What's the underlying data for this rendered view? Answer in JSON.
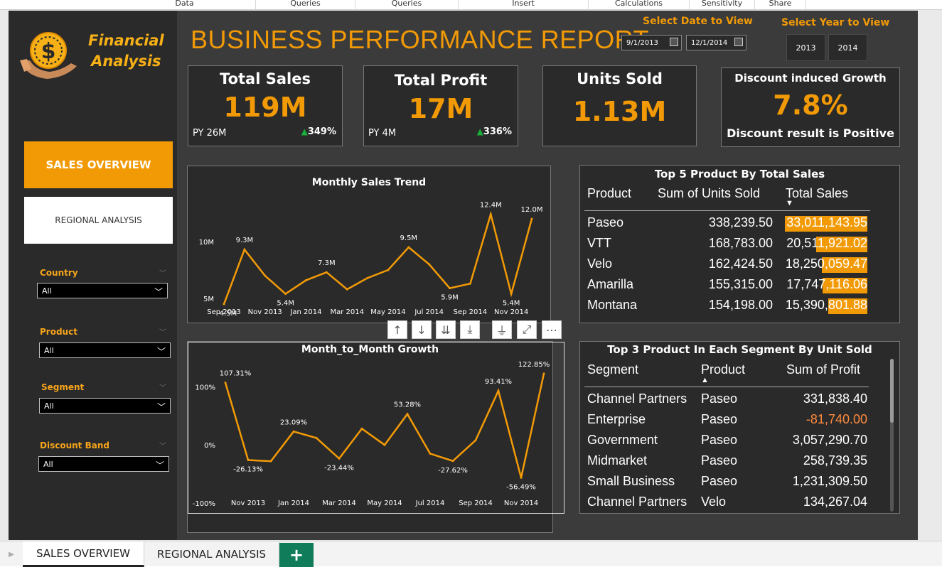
{
  "ribbon": {
    "items": [
      "Data",
      "Queries",
      "Insert",
      "Calculations",
      "Sensitivity",
      "Share"
    ]
  },
  "brand": {
    "line1": "Financial",
    "line2": "Analysis",
    "icon": "dollar-hand-icon"
  },
  "nav": {
    "active": "SALES OVERVIEW",
    "inactive": "REGIONAL ANALYSIS"
  },
  "slicers": [
    {
      "label": "Country",
      "value": "All"
    },
    {
      "label": "Product",
      "value": "All"
    },
    {
      "label": "Segment",
      "value": "All"
    },
    {
      "label": "Discount Band",
      "value": "All"
    }
  ],
  "header": {
    "title": "BUSINESS PERFORMANCE REPORT",
    "date_label": "Select Date to View",
    "date_start": "9/1/2013",
    "date_end": "12/1/2014",
    "year_label": "Select Year to View",
    "years": [
      "2013",
      "2014"
    ]
  },
  "kpis": {
    "sales": {
      "title": "Total Sales",
      "value": "119M",
      "py": "PY 26M",
      "growth": "349%"
    },
    "profit": {
      "title": "Total Profit",
      "value": "17M",
      "py": "PY  4M",
      "growth": "336%"
    },
    "units": {
      "title": "Units Sold",
      "value": "1.13M"
    },
    "discount": {
      "title": "Discount induced Growth",
      "value": "7.8%",
      "note": "Discount result is Positive"
    }
  },
  "colors": {
    "accent": "#f29a06",
    "panel": "#2a2a2a",
    "background": "#3b3b3b",
    "positive": "#19b03a",
    "negative": "#ff8a3d"
  },
  "top5": {
    "title": "Top 5 Product By Total Sales",
    "headers": [
      "Product",
      "Sum of Units Sold",
      "Total Sales"
    ],
    "rows": [
      {
        "product": "Paseo",
        "units": "338,239.50",
        "sales": "33,011,143.95",
        "share": 1.0
      },
      {
        "product": "VTT",
        "units": "168,783.00",
        "sales": "20,511,921.02",
        "share": 0.62
      },
      {
        "product": "Velo",
        "units": "162,424.50",
        "sales": "18,250,059.47",
        "share": 0.55
      },
      {
        "product": "Amarilla",
        "units": "155,315.00",
        "sales": "17,747,116.06",
        "share": 0.54
      },
      {
        "product": "Montana",
        "units": "154,198.00",
        "sales": "15,390,801.88",
        "share": 0.47
      }
    ]
  },
  "top3": {
    "title": "Top 3 Product In Each Segment By Unit Sold",
    "headers": [
      "Segment",
      "Product",
      "Sum of Profit"
    ],
    "rows": [
      {
        "segment": "Channel Partners",
        "product": "Paseo",
        "profit": "331,838.40"
      },
      {
        "segment": "Enterprise",
        "product": "Paseo",
        "profit": "-81,740.00"
      },
      {
        "segment": "Government",
        "product": "Paseo",
        "profit": "3,057,290.70"
      },
      {
        "segment": "Midmarket",
        "product": "Paseo",
        "profit": "258,739.35"
      },
      {
        "segment": "Small Business",
        "product": "Paseo",
        "profit": "1,231,309.50"
      },
      {
        "segment": "Channel Partners",
        "product": "Velo",
        "profit": "134,267.04"
      }
    ]
  },
  "tabs": [
    "SALES OVERVIEW",
    "REGIONAL ANALYSIS"
  ],
  "chart_data": [
    {
      "type": "line",
      "title": "Monthly Sales Trend",
      "x": [
        "Sep 2013",
        "Oct 2013",
        "Nov 2013",
        "Dec 2013",
        "Jan 2014",
        "Feb 2014",
        "Mar 2014",
        "Apr 2014",
        "May 2014",
        "Jun 2014",
        "Jul 2014",
        "Aug 2014",
        "Sep 2014",
        "Oct 2014",
        "Nov 2014",
        "Dec 2014"
      ],
      "x_tick_labels": [
        "Sep 2013",
        "Nov 2013",
        "Jan 2014",
        "Mar 2014",
        "May 2014",
        "Jul 2014",
        "Sep 2014",
        "Nov 2014"
      ],
      "y": [
        4.5,
        9.3,
        7.0,
        5.4,
        6.6,
        7.3,
        5.8,
        6.8,
        7.5,
        9.5,
        8.0,
        5.9,
        6.3,
        12.4,
        5.4,
        12.0
      ],
      "data_labels": {
        "0": "4.5M",
        "1": "9.3M",
        "3": "5.4M",
        "5": "7.3M",
        "9": "9.5M",
        "11": "5.9M",
        "13": "12.4M",
        "14": "5.4M",
        "15": "12.0M"
      },
      "y_ticks": [
        "5M",
        "10M"
      ],
      "y_tick_values": [
        5,
        10
      ],
      "ylim": [
        4,
        13.5
      ],
      "grid": false
    },
    {
      "type": "area",
      "title": "Month_to_Month Growth",
      "x": [
        "Oct 2013",
        "Nov 2013",
        "Dec 2013",
        "Jan 2014",
        "Feb 2014",
        "Mar 2014",
        "Apr 2014",
        "May 2014",
        "Jun 2014",
        "Jul 2014",
        "Aug 2014",
        "Sep 2014",
        "Oct 2014",
        "Nov 2014",
        "Dec 2014"
      ],
      "x_tick_labels": [
        "Nov 2013",
        "Jan 2014",
        "Mar 2014",
        "May 2014",
        "Jul 2014",
        "Sep 2014",
        "Nov 2014"
      ],
      "y": [
        107.31,
        -26.13,
        -28,
        23.09,
        12,
        -23.44,
        28,
        0,
        53.28,
        -15,
        -27.62,
        8,
        93.41,
        -56.49,
        122.85
      ],
      "data_labels": {
        "0": "107.31%",
        "1": "-26.13%",
        "3": "23.09%",
        "5": "-23.44%",
        "8": "53.28%",
        "10": "-27.62%",
        "12": "93.41%",
        "13": "-56.49%",
        "14": "122.85%"
      },
      "y_ticks": [
        "100%",
        "0%",
        "-100%"
      ],
      "y_tick_values": [
        100,
        0,
        -100
      ],
      "ylim": [
        -110,
        135
      ],
      "grid": false
    }
  ]
}
